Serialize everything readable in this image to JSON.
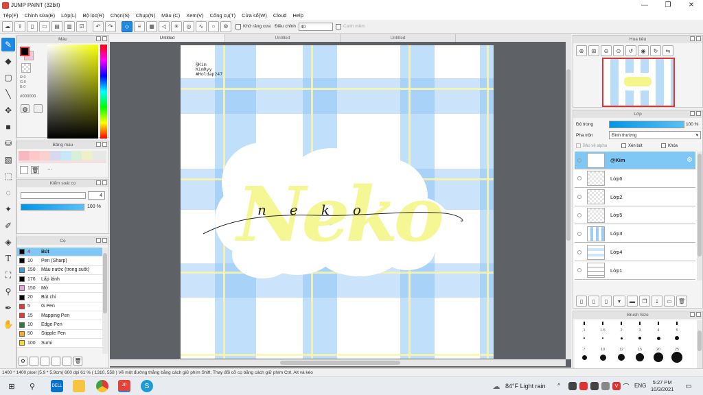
{
  "window": {
    "title": "JUMP PAINT (32bit)",
    "min": "—",
    "max": "❐",
    "close": "✕"
  },
  "menu": [
    "Tệp(F)",
    "Chỉnh sửa(E)",
    "Lớp(L)",
    "Bộ lọc(R)",
    "Chọn(S)",
    "Chụp(N)",
    "Màu (C)",
    "Xem(V)",
    "Công cụ(T)",
    "Cửa sổ(W)",
    "Cloud",
    "Help"
  ],
  "toolbar": {
    "antialias_label": "Khử răng cưa",
    "adjust_label": "Điều chỉnh",
    "adjust_value": "40",
    "snap_label": "Canh mềm"
  },
  "color_panel": {
    "title": "Màu",
    "r": "R:0",
    "g": "G:0",
    "b": "B:0",
    "hex": "#000000",
    "fg": "#000000",
    "bg": "#f8c8d8"
  },
  "swatch_panel": {
    "title": "Bảng màu",
    "dots": "···"
  },
  "brush_control": {
    "title": "Kiểm soát cọ",
    "size": "4",
    "opacity": "100 %"
  },
  "brush_list": {
    "title": "Cọ",
    "items": [
      {
        "size": "4",
        "name": "Bút",
        "color": "#000000",
        "active": true
      },
      {
        "size": "10",
        "name": "Pen (Sharp)",
        "color": "#000000"
      },
      {
        "size": "150",
        "name": "Màu nước (trong suốt)",
        "color": "#3aa0e0"
      },
      {
        "size": "176",
        "name": "Lấp lánh",
        "color": "#000000"
      },
      {
        "size": "150",
        "name": "Mờ",
        "color": "#f0a0e0"
      },
      {
        "size": "20",
        "name": "Bút chì",
        "color": "#000000"
      },
      {
        "size": "5",
        "name": "G Pen",
        "color": "#e53935"
      },
      {
        "size": "15",
        "name": "Mapping Pen",
        "color": "#e53935"
      },
      {
        "size": "10",
        "name": "Edge Pen",
        "color": "#2e7d32"
      },
      {
        "size": "50",
        "name": "Stipple Pen",
        "color": "#f9a825"
      },
      {
        "size": "100",
        "name": "Sumi",
        "color": "#f9d825"
      }
    ]
  },
  "doc_tabs": [
    "Untitled",
    "Untitled",
    "Untitled"
  ],
  "canvas": {
    "credit_lines": [
      "@Kim",
      "KimRyy",
      "#Holdap247"
    ],
    "artwork_text": "Neko",
    "script_text": "neko"
  },
  "navigator": {
    "title": "Hoa tiêu"
  },
  "layers": {
    "title": "Lớp",
    "opacity_label": "Độ trong",
    "opacity_value": "100 %",
    "blend_label": "Pha trộn",
    "blend_value": "Bình thường",
    "protect_alpha": "Bảo vệ alpha",
    "clip": "Xén bút",
    "lock": "Khóa",
    "items": [
      {
        "name": "@Kim",
        "active": true
      },
      {
        "name": "Lớp6"
      },
      {
        "name": "Lớp2"
      },
      {
        "name": "Lớp5"
      },
      {
        "name": "Lớp3"
      },
      {
        "name": "Lớp4"
      },
      {
        "name": "Lớp1"
      }
    ]
  },
  "brush_size": {
    "title": "Brush Size",
    "row1": [
      "1",
      "1.5",
      "2",
      "3",
      "4",
      "5"
    ],
    "row2": [
      "7",
      "10",
      "12",
      "15",
      "20",
      "25"
    ]
  },
  "status": {
    "text": "1400 * 1400 pixel   (5.9 * 5.9cm)  600 dpi   61 %   ( 1310, 558 )   Vẽ một đường thẳng bằng cách giữ phím Shift, Thay đổi cỡ cọ bằng cách giữ phím Ctrl, Alt và kéo"
  },
  "taskbar": {
    "weather": "84°F  Light rain",
    "lang": "ENG",
    "time": "5:27 PM",
    "date": "10/3/2021"
  },
  "icons": {
    "app": "jump-paint-icon",
    "start": "windows-start-icon",
    "search": "search-icon"
  }
}
